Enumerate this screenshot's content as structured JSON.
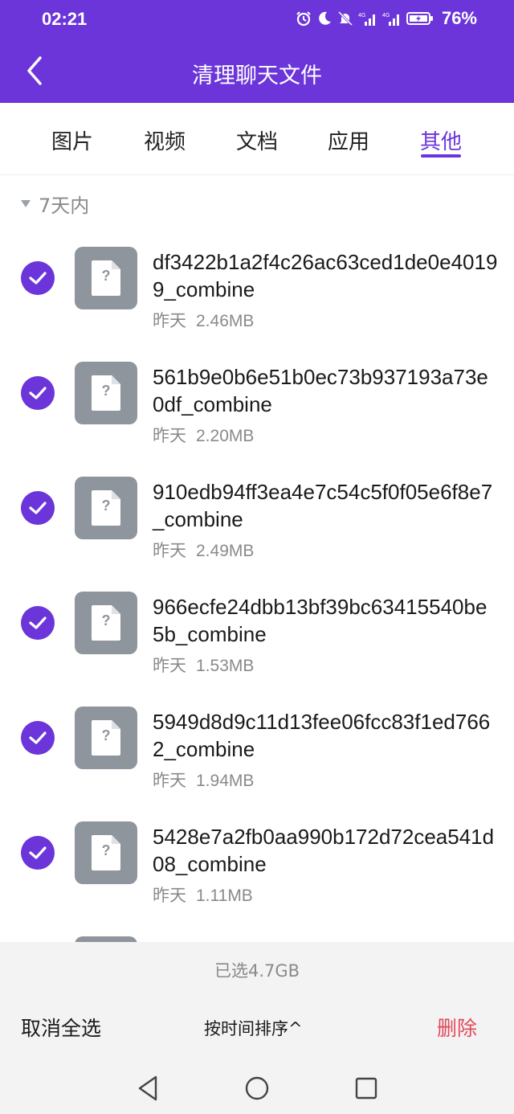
{
  "status": {
    "time": "02:21",
    "battery": "76%",
    "net1": "4G",
    "net2": "4G"
  },
  "header": {
    "title": "清理聊天文件"
  },
  "tabs": [
    {
      "label": "图片",
      "active": false
    },
    {
      "label": "视频",
      "active": false
    },
    {
      "label": "文档",
      "active": false
    },
    {
      "label": "应用",
      "active": false
    },
    {
      "label": "其他",
      "active": true
    }
  ],
  "section": {
    "label": "7天内"
  },
  "files": [
    {
      "name": "df3422b1a2f4c26ac63ced1de0e40199_combine",
      "date": "昨天",
      "size": "2.46MB",
      "checked": true
    },
    {
      "name": "561b9e0b6e51b0ec73b937193a73e0df_combine",
      "date": "昨天",
      "size": "2.20MB",
      "checked": true
    },
    {
      "name": "910edb94ff3ea4e7c54c5f0f05e6f8e7_combine",
      "date": "昨天",
      "size": "2.49MB",
      "checked": true
    },
    {
      "name": "966ecfe24dbb13bf39bc63415540be5b_combine",
      "date": "昨天",
      "size": "1.53MB",
      "checked": true
    },
    {
      "name": "5949d8d9c11d13fee06fcc83f1ed7662_combine",
      "date": "昨天",
      "size": "1.94MB",
      "checked": true
    },
    {
      "name": "5428e7a2fb0aa990b172d72cea541d08_combine",
      "date": "昨天",
      "size": "1.11MB",
      "checked": true
    }
  ],
  "footer": {
    "selected": "已选4.7GB",
    "cancel_all": "取消全选",
    "sort": "按时间排序^",
    "delete": "删除"
  },
  "colors": {
    "accent": "#6b35d9",
    "danger": "#e2495a",
    "file_icon": "#8f959d"
  },
  "icons": {
    "back": "chevron-left-icon",
    "nav_back": "triangle-back-icon",
    "nav_home": "circle-home-icon",
    "nav_recent": "square-recent-icon"
  }
}
